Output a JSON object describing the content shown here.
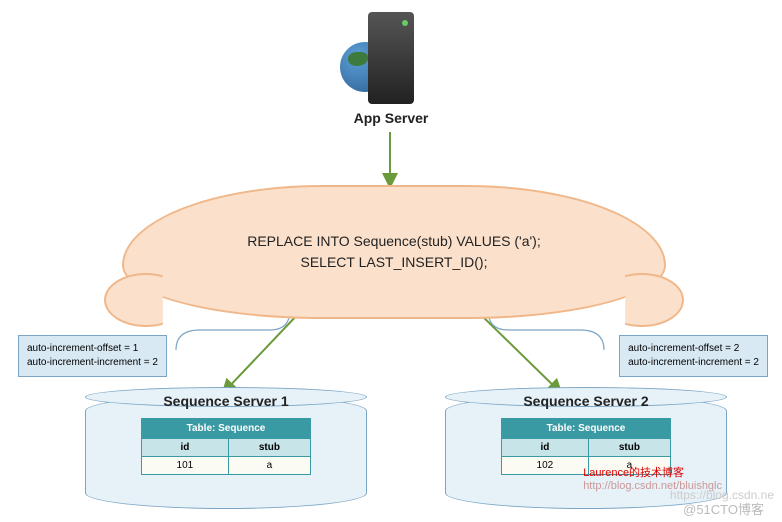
{
  "app_server": {
    "label": "App Server"
  },
  "cloud": {
    "line1": "REPLACE INTO Sequence(stub) VALUES ('a');",
    "line2": "SELECT LAST_INSERT_ID();"
  },
  "config1": {
    "line1": "auto-increment-offset = 1",
    "line2": "auto-increment-increment = 2"
  },
  "config2": {
    "line1": "auto-increment-offset = 2",
    "line2": "auto-increment-increment = 2"
  },
  "server1": {
    "title": "Sequence Server 1",
    "table_title": "Table: Sequence",
    "col1": "id",
    "col2": "stub",
    "val1": "101",
    "val2": "a"
  },
  "server2": {
    "title": "Sequence Server 2",
    "table_title": "Table: Sequence",
    "col1": "id",
    "col2": "stub",
    "val1": "102",
    "val2": "a"
  },
  "credit": {
    "line1": "Laurence的技术博客",
    "line2": "http://blog.csdn.net/bluishglc"
  },
  "watermark1": "@51CTO博客",
  "watermark2": "https://blog.csdn.ne"
}
